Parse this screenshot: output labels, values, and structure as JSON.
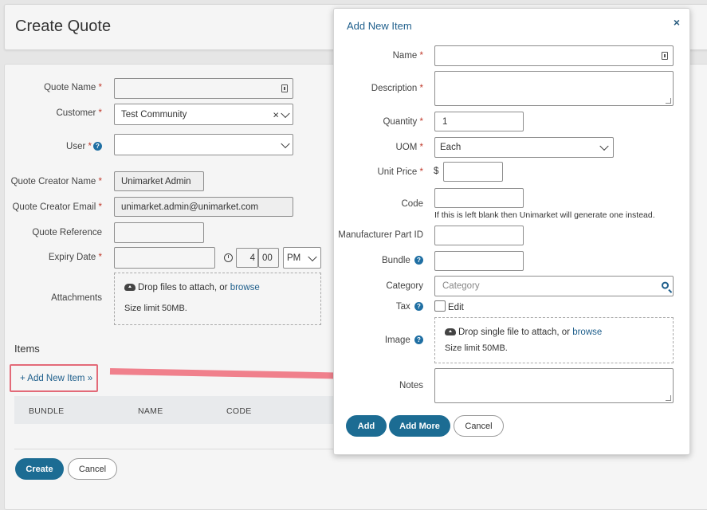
{
  "page": {
    "title": "Create Quote",
    "required_mark": "*",
    "help_mark": "?",
    "fields": {
      "quote_name": {
        "label": "Quote Name",
        "value": ""
      },
      "customer": {
        "label": "Customer",
        "value": "Test Community",
        "clear": "×"
      },
      "user": {
        "label": "User",
        "value": ""
      },
      "quote_creator_name": {
        "label": "Quote Creator Name",
        "value": "Unimarket Admin"
      },
      "quote_creator_email": {
        "label": "Quote Creator Email",
        "value": "unimarket.admin@unimarket.com"
      },
      "quote_reference": {
        "label": "Quote Reference",
        "value": ""
      },
      "expiry_date": {
        "label": "Expiry Date",
        "date": "",
        "hour": "4",
        "minute": "00",
        "ampm": "PM"
      },
      "attachments": {
        "label": "Attachments",
        "drop_text": "Drop files to attach, or",
        "browse": "browse",
        "size_limit": "Size limit 50MB."
      }
    },
    "items": {
      "title": "Items",
      "add_button": "+ Add New Item »",
      "columns": [
        "BUNDLE",
        "NAME",
        "CODE"
      ]
    },
    "buttons": {
      "create": "Create",
      "cancel": "Cancel"
    }
  },
  "modal": {
    "title": "Add New Item",
    "close": "×",
    "fields": {
      "name": {
        "label": "Name",
        "value": ""
      },
      "description": {
        "label": "Description",
        "value": ""
      },
      "quantity": {
        "label": "Quantity",
        "value": "1"
      },
      "uom": {
        "label": "UOM",
        "value": "Each"
      },
      "unit_price": {
        "label": "Unit Price",
        "currency": "$",
        "value": ""
      },
      "code": {
        "label": "Code",
        "value": "",
        "hint": "If this is left blank then Unimarket will generate one instead."
      },
      "manufacturer_part_id": {
        "label": "Manufacturer Part ID",
        "value": ""
      },
      "bundle": {
        "label": "Bundle",
        "value": ""
      },
      "category": {
        "label": "Category",
        "placeholder": "Category"
      },
      "tax": {
        "label": "Tax",
        "checkbox_label": "Edit"
      },
      "image": {
        "label": "Image",
        "drop_text": "Drop single file to attach, or",
        "browse": "browse",
        "size_limit": "Size limit 50MB."
      },
      "notes": {
        "label": "Notes",
        "value": ""
      }
    },
    "buttons": {
      "add": "Add",
      "add_more": "Add More",
      "cancel": "Cancel"
    }
  },
  "colors": {
    "primary": "#1c6c93",
    "link": "#1f5f8c",
    "required": "#c0392b",
    "highlight": "#e36a78"
  }
}
